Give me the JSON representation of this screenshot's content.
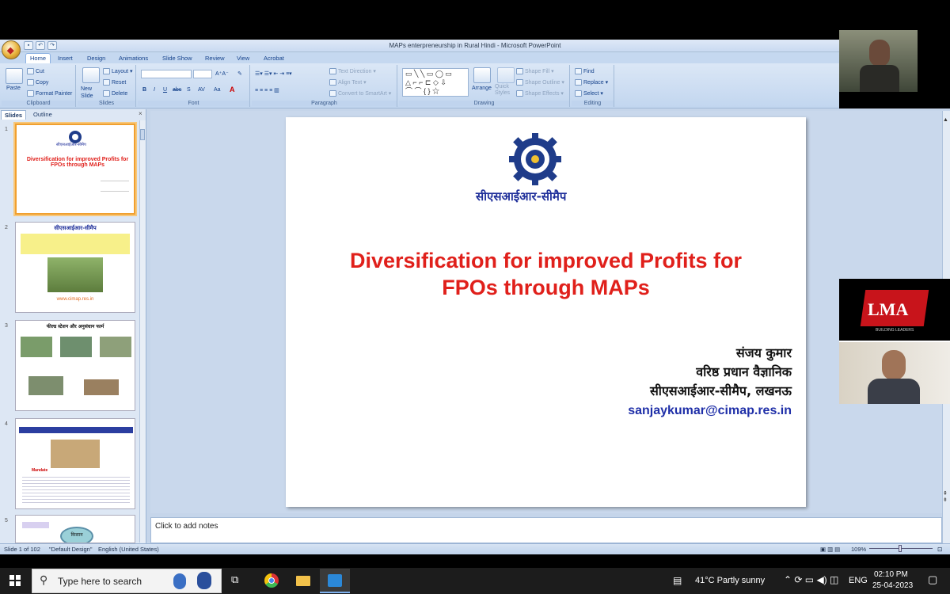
{
  "window": {
    "title": "MAPs enterpreneurship in Rural Hindi - Microsoft PowerPoint"
  },
  "tabs": [
    "Home",
    "Insert",
    "Design",
    "Animations",
    "Slide Show",
    "Review",
    "View",
    "Acrobat"
  ],
  "ribbon": {
    "clipboard": {
      "paste": "Paste",
      "cut": "Cut",
      "copy": "Copy",
      "format_painter": "Format Painter",
      "label": "Clipboard"
    },
    "slides": {
      "new_slide": "New Slide",
      "layout": "Layout",
      "reset": "Reset",
      "delete": "Delete",
      "label": "Slides"
    },
    "font": {
      "label": "Font",
      "bold": "B",
      "italic": "I",
      "underline": "U",
      "strike": "abc",
      "shadow": "S",
      "spacing": "AV",
      "case": "Aa"
    },
    "paragraph": {
      "text_direction": "Text Direction",
      "align_text": "Align Text",
      "convert": "Convert to SmartArt",
      "label": "Paragraph"
    },
    "drawing": {
      "arrange": "Arrange",
      "quick_styles": "Quick Styles",
      "shape_fill": "Shape Fill",
      "shape_outline": "Shape Outline",
      "shape_effects": "Shape Effects",
      "label": "Drawing"
    },
    "editing": {
      "find": "Find",
      "replace": "Replace",
      "select": "Select",
      "label": "Editing"
    }
  },
  "panel": {
    "tab_slides": "Slides",
    "tab_outline": "Outline",
    "close": "×",
    "thumbs": [
      {
        "num": "1",
        "title": "Diversification for improved Profits for FPOs through MAPs",
        "org": "सीएसआईआर-सीमैप"
      },
      {
        "num": "2",
        "title": "सीएसआईआर-सीमैप",
        "url": "www.cimap.res.in"
      },
      {
        "num": "3",
        "title": "फील्ड स्टेशन और अनुसंधान फार्म"
      },
      {
        "num": "4",
        "title": "Mandate"
      },
      {
        "num": "5",
        "title": "किसान"
      }
    ]
  },
  "slide": {
    "org_name": "सीएसआईआर-सीमैप",
    "title_line1": "Diversification for improved Profits for",
    "title_line2": "FPOs through MAPs",
    "author": "संजय कुमार",
    "designation": "वरिष्ठ प्रधान वैज्ञानिक",
    "affiliation": "सीएसआईआर-सीमैप, लखनऊ",
    "email": "sanjaykumar@cimap.res.in",
    "colors": {
      "title": "#e0201b",
      "email": "#1f2fa8",
      "org": "#1f2f9a"
    }
  },
  "notes": {
    "placeholder": "Click to add notes"
  },
  "status": {
    "slide": "Slide 1 of 102",
    "theme": "\"Default Design\"",
    "language": "English (United States)",
    "zoom": "109%"
  },
  "video": {
    "logo_text": "LMA",
    "logo_sub": "BUILDING LEADERS"
  },
  "taskbar": {
    "search_placeholder": "Type here to search",
    "weather": "41°C  Partly sunny",
    "lang": "ENG",
    "time": "02:10 PM",
    "date": "25-04-2023"
  }
}
